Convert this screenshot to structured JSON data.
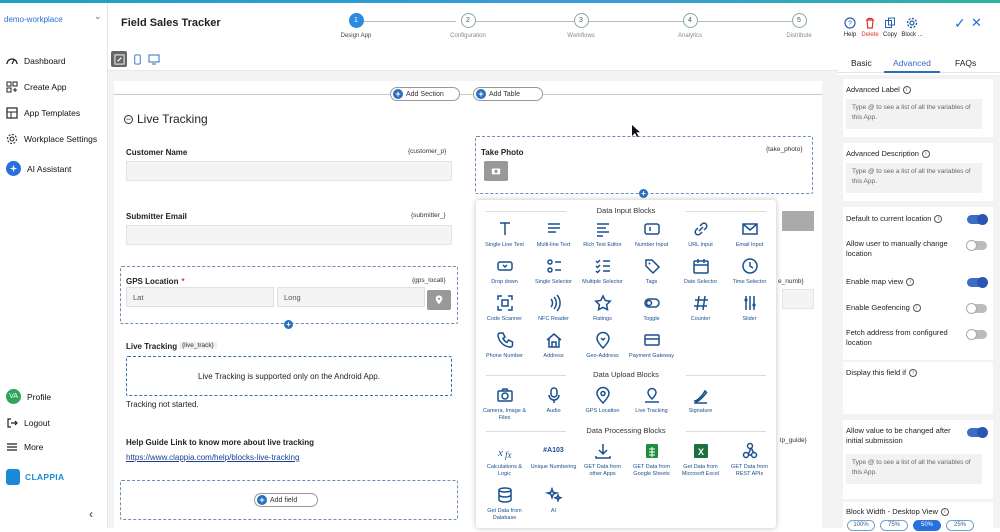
{
  "workspace": "demo-workplace",
  "nav": [
    {
      "label": "Dashboard",
      "icon": "dashboard-icon"
    },
    {
      "label": "Create App",
      "icon": "create-app-icon"
    },
    {
      "label": "App Templates",
      "icon": "templates-icon"
    },
    {
      "label": "Workplace Settings",
      "icon": "gear-icon"
    },
    {
      "label": "AI Assistant",
      "icon": "ai-icon"
    }
  ],
  "profile": {
    "initials": "VA",
    "label": "Profile"
  },
  "logout": "Logout",
  "more": "More",
  "brand": "CLAPPIA",
  "app_title": "Field Sales Tracker",
  "steps": [
    {
      "num": "1",
      "label": "Design App",
      "active": true
    },
    {
      "num": "2",
      "label": "Configuration",
      "active": false
    },
    {
      "num": "3",
      "label": "Workflows",
      "active": false
    },
    {
      "num": "4",
      "label": "Analytics",
      "active": false
    },
    {
      "num": "5",
      "label": "Distribute",
      "active": false
    }
  ],
  "toolbar": {
    "add_section": "Add Section",
    "add_table": "Add Table"
  },
  "section": {
    "title": "Live Tracking"
  },
  "fields": {
    "customer_name": {
      "label": "Customer Name",
      "var": "{customer_p}"
    },
    "submitter_email": {
      "label": "Submitter Email",
      "var": "{submitter_}"
    },
    "gps": {
      "label": "GPS Location",
      "required": "*",
      "var": "{gps_locati}",
      "lat": "Lat",
      "long": "Long"
    },
    "live_track": {
      "label": "Live Tracking",
      "var": "{live_track}",
      "msg": "Live Tracking is supported only on the Android App.",
      "status": "Tracking not started."
    },
    "help": {
      "label": "Help Guide Link to know more about live tracking",
      "link": "https://www.clappia.com/help/blocks-live-tracking"
    },
    "add_field": "Add field",
    "take_photo": {
      "label": "Take Photo",
      "var": "{take_photo}"
    },
    "partial_var_1": "e_numb}",
    "partial_var_2": "lp_guide}"
  },
  "blocks": {
    "input_title": "Data Input Blocks",
    "input": [
      "Single Line Text",
      "Multi-line Text",
      "Rich Text Editor",
      "Number Input",
      "URL Input",
      "Email Input",
      "Drop down",
      "Single Selector",
      "Multiple Selector",
      "Tags",
      "Date Selector",
      "Time Selector",
      "Code Scanner",
      "NFC Reader",
      "Ratings",
      "Toggle",
      "Counter",
      "Slider",
      "Phone Number",
      "Address",
      "Geo-Address",
      "Payment Gateway"
    ],
    "upload_title": "Data Upload Blocks",
    "upload": [
      "Camera, Image & Files",
      "Audio",
      "GPS Location",
      "Live Tracking",
      "Signature"
    ],
    "processing_title": "Data Processing Blocks",
    "processing": [
      "Calculations & Logic",
      "Unique Numbering",
      "GET Data from other Apps",
      "GET Data from Google Sheets",
      "Get Data from Microsoft Excel",
      "GET Data from REST APIs",
      "Get Data from Database",
      "AI"
    ],
    "unique_badge": "#A103"
  },
  "right": {
    "tools": [
      "Help",
      "Delete",
      "Copy",
      "Block ..."
    ],
    "tabs": [
      "Basic",
      "Advanced",
      "FAQs"
    ],
    "adv_label": "Advanced Label",
    "adv_desc": "Advanced Description",
    "placeholder": "Type @ to see a list of all the variables of this App.",
    "toggles": [
      {
        "label": "Default to current location",
        "on": true
      },
      {
        "label": "Allow user to manually change location",
        "on": false
      },
      {
        "label": "Enable map view",
        "on": true
      },
      {
        "label": "Enable Geofencing",
        "on": false
      },
      {
        "label": "Fetch address from configured location",
        "on": false
      }
    ],
    "display_if": "Display this field if",
    "allow_change": "Allow value to be changed after initial submission",
    "block_width": "Block Width - Desktop View",
    "widths": [
      "100%",
      "75%",
      "50%",
      "25%"
    ],
    "active_width": "50%"
  },
  "colors": {
    "accent": "#2a6fdb",
    "danger": "#d9362b",
    "brand": "#1b8ad4"
  }
}
